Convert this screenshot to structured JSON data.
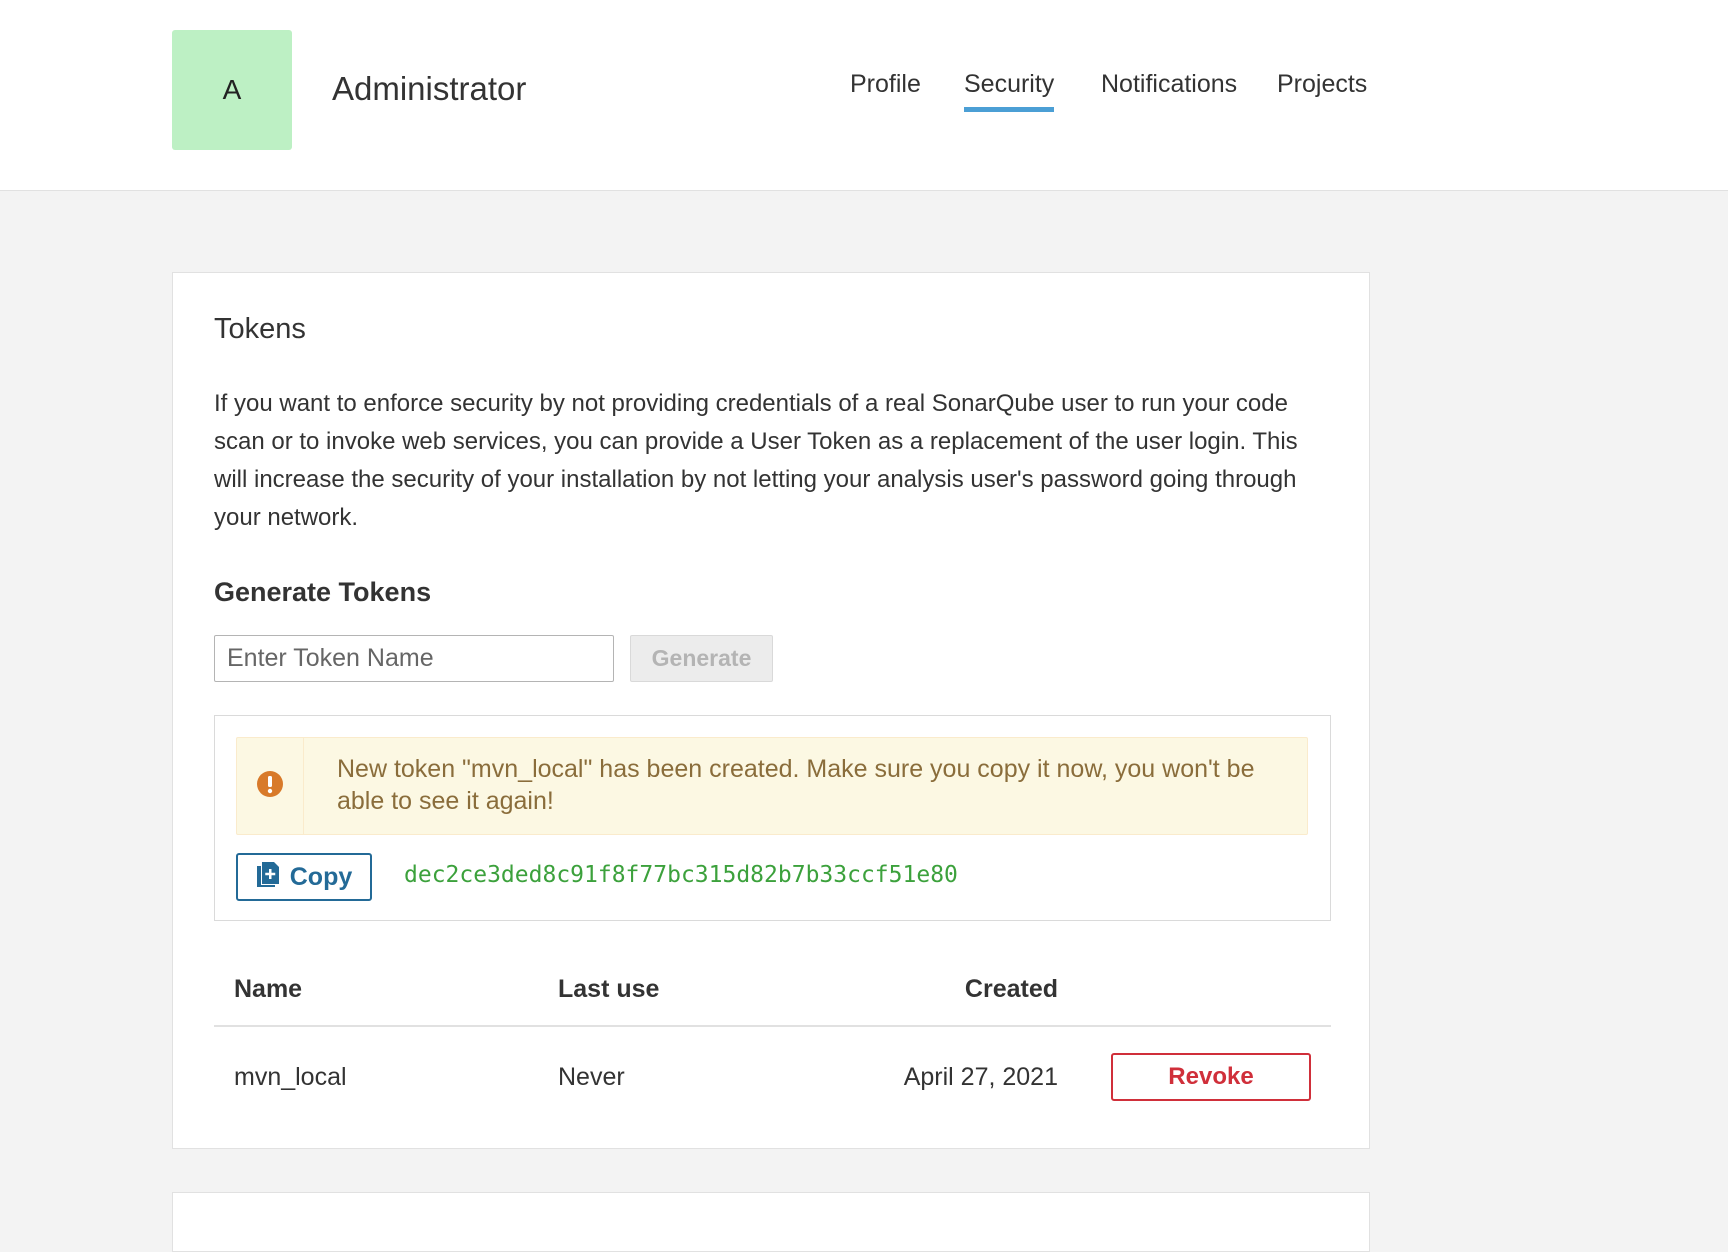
{
  "header": {
    "avatar_letter": "A",
    "user_name": "Administrator",
    "tabs": [
      {
        "label": "Profile",
        "active": false
      },
      {
        "label": "Security",
        "active": true
      },
      {
        "label": "Notifications",
        "active": false
      },
      {
        "label": "Projects",
        "active": false
      }
    ]
  },
  "tokens": {
    "title": "Tokens",
    "description": "If you want to enforce security by not providing credentials of a real SonarQube user to run your code scan or to invoke web services, you can provide a User Token as a replacement of the user login. This will increase the security of your installation by not letting your analysis user's password going through your network.",
    "generate_heading": "Generate Tokens",
    "input_placeholder": "Enter Token Name",
    "input_value": "",
    "generate_label": "Generate",
    "alert_message": "New token \"mvn_local\" has been created. Make sure you copy it now, you won't be able to see it again!",
    "copy_label": "Copy",
    "token_value": "dec2ce3ded8c91f8f77bc315d82b7b33ccf51e80",
    "table": {
      "headers": {
        "name": "Name",
        "last_use": "Last use",
        "created": "Created"
      },
      "rows": [
        {
          "name": "mvn_local",
          "last_use": "Never",
          "created": "April 27, 2021",
          "action": "Revoke"
        }
      ]
    }
  },
  "colors": {
    "avatar_bg": "#bdf0c4",
    "active_tab_underline": "#4b9fd5",
    "alert_bg": "#fcf8e3",
    "alert_icon": "#d87a2a",
    "copy_button": "#236a97",
    "token_text": "#3ca13c",
    "revoke_button": "#d02f3a"
  },
  "icons": {
    "alert": "exclamation-circle-icon",
    "copy": "clipboard-icon"
  }
}
